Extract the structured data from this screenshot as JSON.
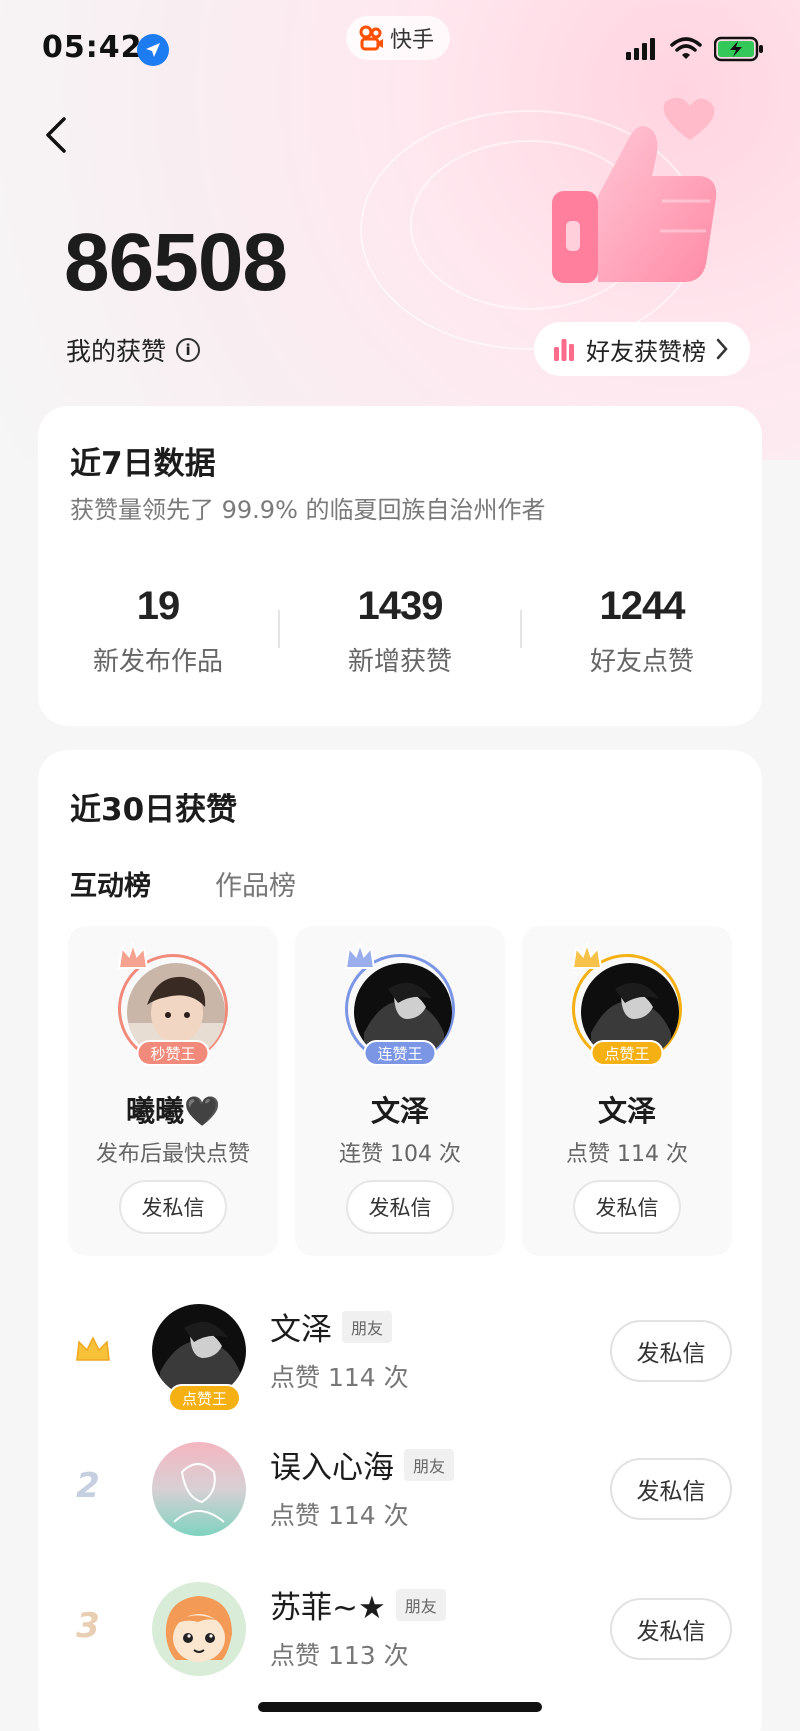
{
  "status_bar": {
    "time": "05:42",
    "app_name": "快手"
  },
  "header": {
    "total_likes": "86508",
    "my_likes_label": "我的获赞",
    "friends_rank_label": "好友获赞榜"
  },
  "week_card": {
    "title": "近7日数据",
    "subtitle": "获赞量领先了 99.9% 的临夏回族自治州作者",
    "stats": [
      {
        "value": "19",
        "label": "新发布作品"
      },
      {
        "value": "1439",
        "label": "新增获赞"
      },
      {
        "value": "1244",
        "label": "好友点赞"
      }
    ]
  },
  "month_card": {
    "title": "近30日获赞",
    "tabs": [
      "互动榜",
      "作品榜"
    ],
    "top3": [
      {
        "badge": "秒赞王",
        "name": "曦曦🖤",
        "desc": "发布后最快点赞",
        "button": "发私信",
        "color": "#f28a7c"
      },
      {
        "badge": "连赞王",
        "name": "文泽",
        "desc": "连赞 104 次",
        "button": "发私信",
        "color": "#7c96e6"
      },
      {
        "badge": "点赞王",
        "name": "文泽",
        "desc": "点赞 114 次",
        "button": "发私信",
        "color": "#f5b013"
      }
    ],
    "list": [
      {
        "rank": "",
        "name": "文泽",
        "tag": "朋友",
        "sub": "点赞 114 次",
        "badge": "点赞王",
        "button": "发私信"
      },
      {
        "rank": "2",
        "name": "误入心海",
        "tag": "朋友",
        "sub": "点赞 114 次",
        "button": "发私信"
      },
      {
        "rank": "3",
        "name": "苏菲~★",
        "tag": "朋友",
        "sub": "点赞 113 次",
        "button": "发私信"
      }
    ]
  }
}
